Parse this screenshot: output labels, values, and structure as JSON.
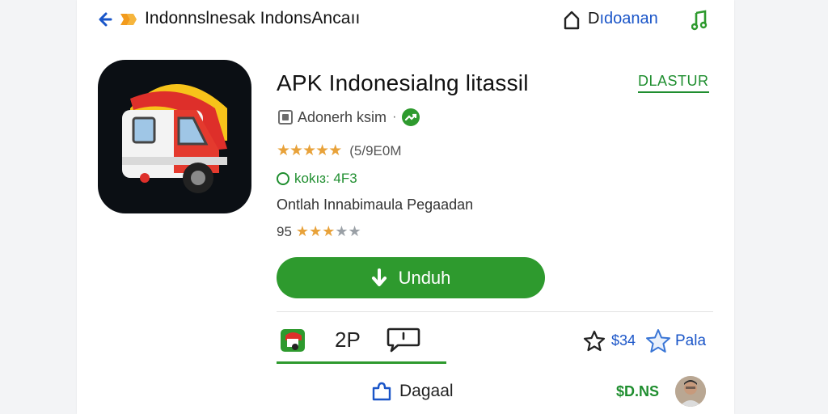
{
  "topbar": {
    "title": "Indonnslnesak IndonsAncaıı",
    "download_first": "D",
    "download_rest": "ıdoanan"
  },
  "app": {
    "name": "APK Indonesialng litassil",
    "install_badge": "DLASTUR",
    "developer": "Adonerh ksim",
    "dev_separator": "·",
    "rating_count": "(5/9E0M",
    "size": "kokıɜ: 4F3",
    "description": "Ontlah Innabimaula Pegaadan",
    "score": "95",
    "score_stars": {
      "filled": 3,
      "total": 5
    }
  },
  "actions": {
    "download_label": "Unduh"
  },
  "tabs": {
    "count": "2P",
    "price": "$34",
    "pay_label": "Pala"
  },
  "footer": {
    "detail_label": "Dagaal",
    "price": "$D.NS"
  },
  "colors": {
    "accent_green": "#2e9a2e",
    "link_blue": "#1a55c8",
    "star_gold": "#e8a23a"
  }
}
